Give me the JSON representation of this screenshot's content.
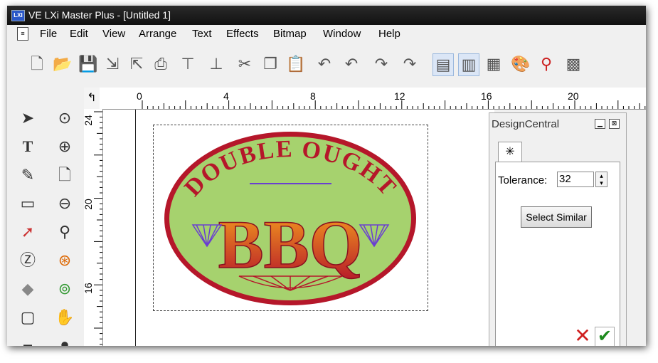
{
  "window": {
    "title": "VE LXi Master Plus - [Untitled 1]",
    "app_icon_text": "LXI"
  },
  "menu": {
    "items": [
      "File",
      "Edit",
      "View",
      "Arrange",
      "Text",
      "Effects",
      "Bitmap",
      "Window",
      "Help"
    ]
  },
  "toolbar": {
    "icons": [
      "new-icon",
      "open-icon",
      "save-icon",
      "import-icon",
      "export-icon",
      "print-icon",
      "plot-icon",
      "cut-mark-icon",
      "cut-icon",
      "copy-icon",
      "paste-icon",
      "undo-icon",
      "undo-all-icon",
      "redo-icon",
      "redo-all-icon",
      "view-a-icon",
      "view-b-icon",
      "view-c-icon",
      "color-palette-icon",
      "color-drop-icon",
      "swatch-icon"
    ]
  },
  "ruler": {
    "horizontal_labels": [
      "0",
      "4",
      "8",
      "12",
      "16",
      "20"
    ],
    "vertical_labels": [
      "24",
      "20",
      "16"
    ]
  },
  "design": {
    "arc_text": "DOUBLE OUGHT",
    "main_text": "BBQ",
    "colors": {
      "fill_green": "#a6d26e",
      "border_red": "#b5172a",
      "text_orange": "#f39a1e",
      "text_red": "#b5172a",
      "ornament_purple": "#6a3fd0"
    }
  },
  "panel": {
    "title": "DesignCentral",
    "tab_icon": "magic-wand-icon",
    "tolerance_label": "Tolerance:",
    "tolerance_value": "32",
    "select_similar_label": "Select Similar"
  }
}
